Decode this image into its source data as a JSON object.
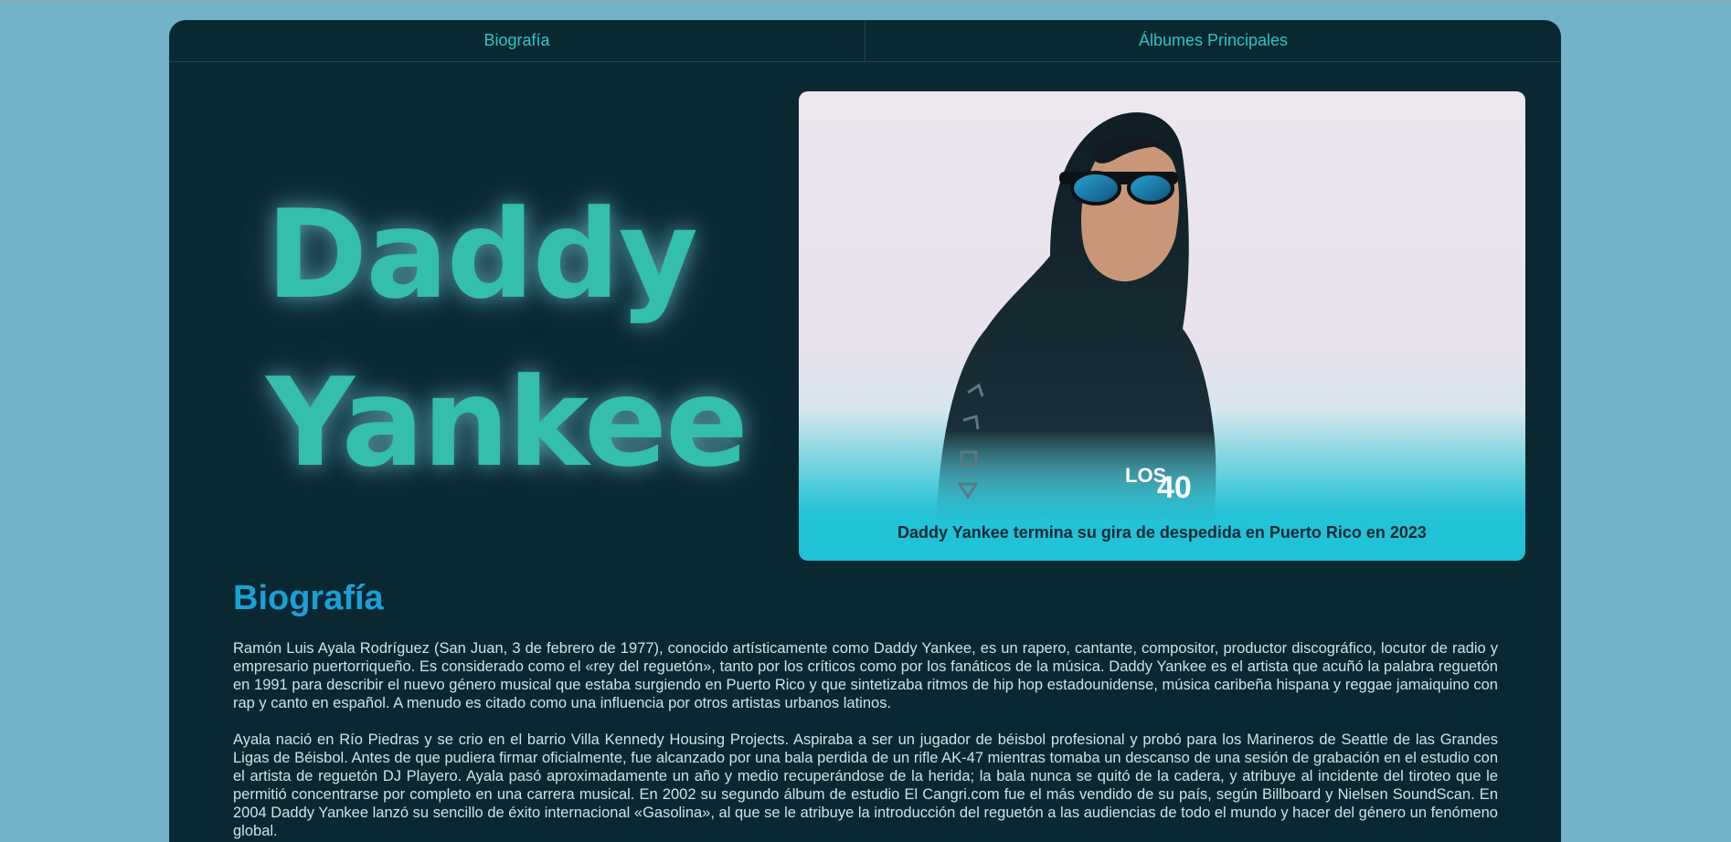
{
  "nav": {
    "tabs": [
      {
        "label": "Biografía"
      },
      {
        "label": "Álbumes Principales"
      }
    ]
  },
  "hero": {
    "title_line1": "Daddy",
    "title_line2": "Yankee"
  },
  "photo": {
    "caption": "Daddy Yankee termina su gira de despedida en Puerto Rico en 2023",
    "watermark": "LOS 40"
  },
  "biography": {
    "heading": "Biografía",
    "paragraphs": [
      "Ramón Luis Ayala Rodríguez (San Juan, 3 de febrero de 1977), conocido artísticamente como Daddy Yankee, es un rapero, cantante, compositor, productor discográfico, locutor de radio y empresario puertorriqueño. Es considerado como el «rey del reguetón», tanto por los críticos como por los fanáticos de la música. Daddy Yankee es el artista que acuñó la palabra reguetón en 1991 para describir el nuevo género musical que estaba surgiendo en Puerto Rico y que sintetizaba ritmos de hip hop estadounidense, música caribeña hispana y reggae jamaiquino con rap y canto en español. A menudo es citado como una influencia por otros artistas urbanos latinos.",
      "Ayala nació en Río Piedras y se crio en el barrio Villa Kennedy Housing Projects. Aspiraba a ser un jugador de béisbol profesional y probó para los Marineros de Seattle de las Grandes Ligas de Béisbol. Antes de que pudiera firmar oficialmente, fue alcanzado por una bala perdida de un rifle AK-47 mientras tomaba un descanso de una sesión de grabación en el estudio con el artista de reguetón DJ Playero. Ayala pasó aproximadamente un año y medio recuperándose de la herida; la bala nunca se quitó de la cadera, y atribuye al incidente del tiroteo que le permitió concentrarse por completo en una carrera musical. En 2002 su segundo álbum de estudio El Cangri.com fue el más vendido de su país, según Billboard y Nielsen SoundScan. En 2004 Daddy Yankee lanzó su sencillo de éxito internacional «Gasolina», al que se le atribuye la introducción del reguetón a las audiencias de todo el mundo y hacer del género un fenómeno global."
    ]
  }
}
